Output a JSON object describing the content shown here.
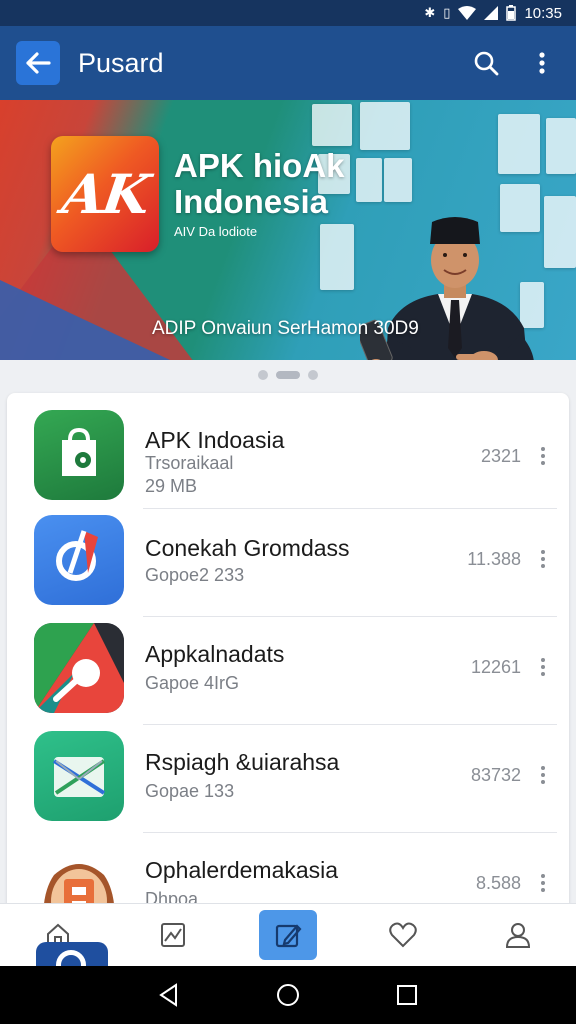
{
  "status_bar": {
    "time": "10:35"
  },
  "app_bar": {
    "title": "Pusard"
  },
  "banner": {
    "logo_text": "AK",
    "title": "APK hioAk Indonesia",
    "subtitle": "AIV Da lodiote",
    "caption": "ADIP Onvaiun SerHamon 30D9"
  },
  "apps": [
    {
      "name": "APK Indoasia",
      "meta1": "Trsoraikaal",
      "meta2": "29 MB",
      "count": "2321"
    },
    {
      "name": "Conekah Gromdass",
      "meta1": "Gopoe2 233",
      "meta2": "",
      "count": "11.388"
    },
    {
      "name": "Appkalnadats",
      "meta1": "Gapoe 4IrG",
      "meta2": "",
      "count": "12261"
    },
    {
      "name": "Rspiagh &uiarahsa",
      "meta1": "Gopae 133",
      "meta2": "",
      "count": "83732"
    },
    {
      "name": "Ophalerdemakasia",
      "meta1": "Dhpoa",
      "meta2": "",
      "count": "8.588"
    }
  ],
  "colors": {
    "primary": "#1f4f8f",
    "accent": "#4d97e8",
    "status": "#16345f"
  }
}
